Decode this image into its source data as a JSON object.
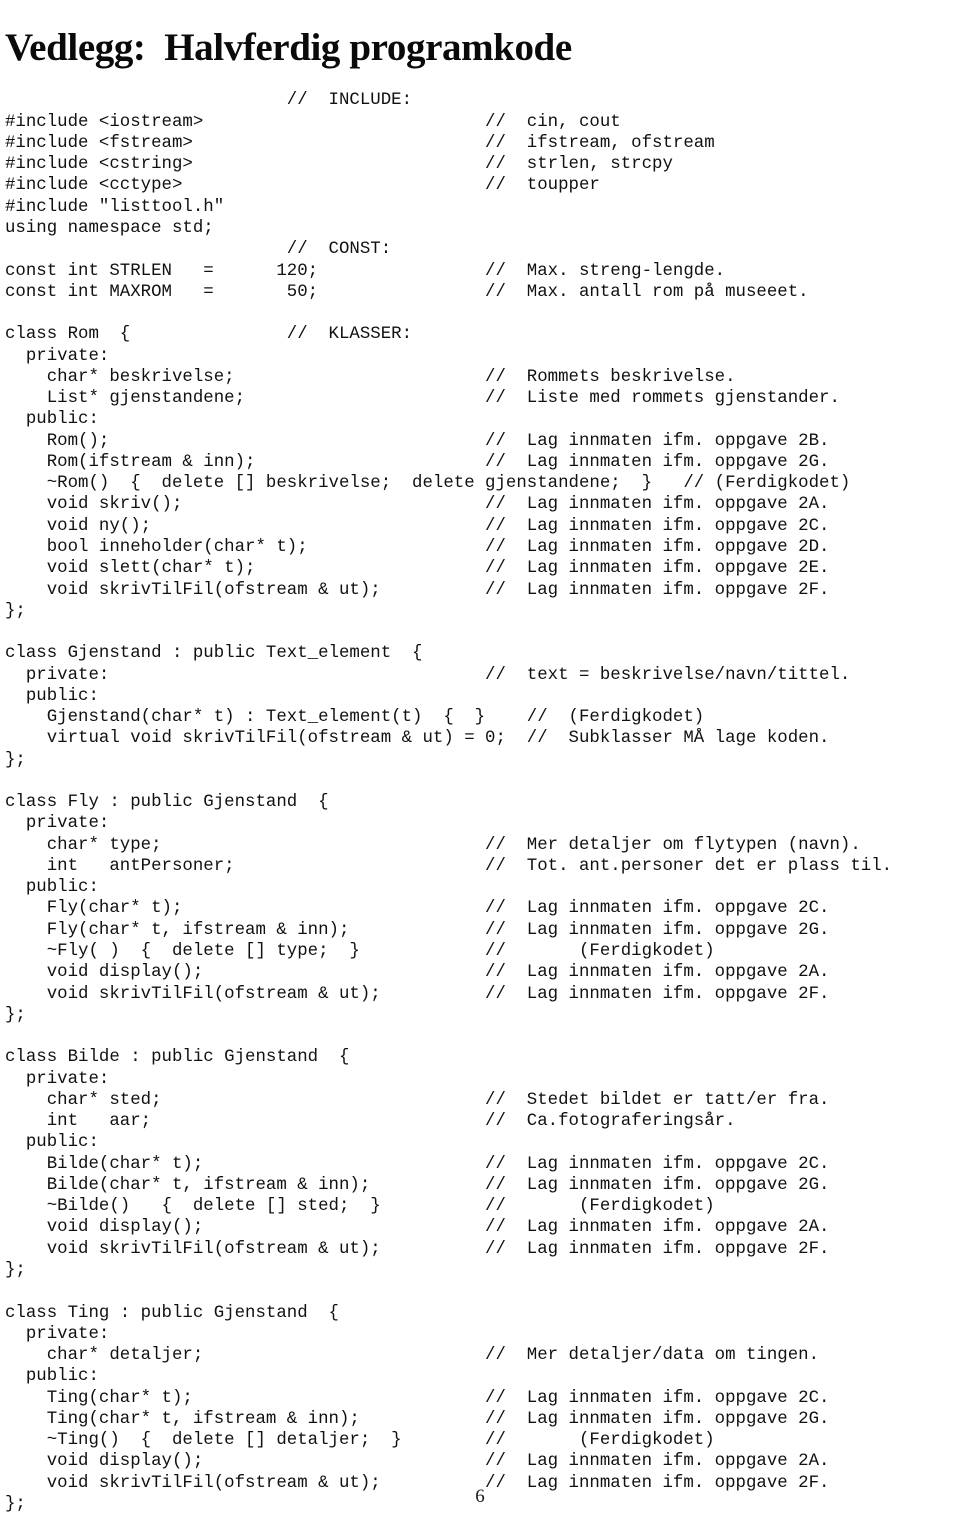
{
  "document": {
    "title": "Vedlegg:  Halvferdig programkode",
    "page_number": "6",
    "code_lines": [
      "                           //  INCLUDE:",
      "#include <iostream>                           //  cin, cout",
      "#include <fstream>                            //  ifstream, ofstream",
      "#include <cstring>                            //  strlen, strcpy",
      "#include <cctype>                             //  toupper",
      "#include \"listtool.h\"",
      "using namespace std;",
      "                           //  CONST:",
      "const int STRLEN   =      120;                //  Max. streng-lengde.",
      "const int MAXROM   =       50;                //  Max. antall rom på museeet.",
      "",
      "class Rom  {               //  KLASSER:",
      "  private:",
      "    char* beskrivelse;                        //  Rommets beskrivelse.",
      "    List* gjenstandene;                       //  Liste med rommets gjenstander.",
      "  public:",
      "    Rom();                                    //  Lag innmaten ifm. oppgave 2B.",
      "    Rom(ifstream & inn);                      //  Lag innmaten ifm. oppgave 2G.",
      "    ~Rom()  {  delete [] beskrivelse;  delete gjenstandene;  }   // (Ferdigkodet)",
      "    void skriv();                             //  Lag innmaten ifm. oppgave 2A.",
      "    void ny();                                //  Lag innmaten ifm. oppgave 2C.",
      "    bool inneholder(char* t);                 //  Lag innmaten ifm. oppgave 2D.",
      "    void slett(char* t);                      //  Lag innmaten ifm. oppgave 2E.",
      "    void skrivTilFil(ofstream & ut);          //  Lag innmaten ifm. oppgave 2F.",
      "};",
      "",
      "class Gjenstand : public Text_element  {",
      "  private:                                    //  text = beskrivelse/navn/tittel.",
      "  public:",
      "    Gjenstand(char* t) : Text_element(t)  {  }    //  (Ferdigkodet)",
      "    virtual void skrivTilFil(ofstream & ut) = 0;  //  Subklasser MÅ lage koden.",
      "};",
      "",
      "class Fly : public Gjenstand  {",
      "  private:",
      "    char* type;                               //  Mer detaljer om flytypen (navn).",
      "    int   antPersoner;                        //  Tot. ant.personer det er plass til.",
      "  public:",
      "    Fly(char* t);                             //  Lag innmaten ifm. oppgave 2C.",
      "    Fly(char* t, ifstream & inn);             //  Lag innmaten ifm. oppgave 2G.",
      "    ~Fly( )  {  delete [] type;  }            //       (Ferdigkodet)",
      "    void display();                           //  Lag innmaten ifm. oppgave 2A.",
      "    void skrivTilFil(ofstream & ut);          //  Lag innmaten ifm. oppgave 2F.",
      "};",
      "",
      "class Bilde : public Gjenstand  {",
      "  private:",
      "    char* sted;                               //  Stedet bildet er tatt/er fra.",
      "    int   aar;                                //  Ca.fotograferingsår.",
      "  public:",
      "    Bilde(char* t);                           //  Lag innmaten ifm. oppgave 2C.",
      "    Bilde(char* t, ifstream & inn);           //  Lag innmaten ifm. oppgave 2G.",
      "    ~Bilde()   {  delete [] sted;  }          //       (Ferdigkodet)",
      "    void display();                           //  Lag innmaten ifm. oppgave 2A.",
      "    void skrivTilFil(ofstream & ut);          //  Lag innmaten ifm. oppgave 2F.",
      "};",
      "",
      "class Ting : public Gjenstand  {",
      "  private:",
      "    char* detaljer;                           //  Mer detaljer/data om tingen.",
      "  public:",
      "    Ting(char* t);                            //  Lag innmaten ifm. oppgave 2C.",
      "    Ting(char* t, ifstream & inn);            //  Lag innmaten ifm. oppgave 2G.",
      "    ~Ting()  {  delete [] detaljer;  }        //       (Ferdigkodet)",
      "    void display();                           //  Lag innmaten ifm. oppgave 2A.",
      "    void skrivTilFil(ofstream & ut);          //  Lag innmaten ifm. oppgave 2F.",
      "};"
    ]
  }
}
